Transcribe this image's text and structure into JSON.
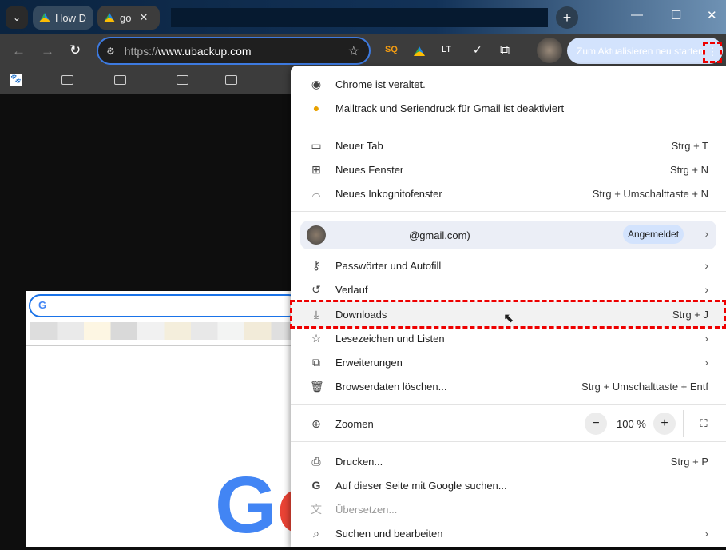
{
  "tabs": [
    {
      "title": "How D"
    },
    {
      "title": "go"
    }
  ],
  "tab_close": "✕",
  "new_tab": "+",
  "window": {
    "minimize": "—",
    "maximize": "☐",
    "close": "✕"
  },
  "address": {
    "url_prefix": "https://",
    "url_host": "www.ubackup.com"
  },
  "update_button": "Zum Aktualisieren neu starten",
  "menu": {
    "notices": [
      {
        "label": "Chrome ist veraltet."
      },
      {
        "label": "Mailtrack und Seriendruck für Gmail ist deaktiviert"
      }
    ],
    "group1": [
      {
        "label": "Neuer Tab",
        "shortcut": "Strg + T"
      },
      {
        "label": "Neues Fenster",
        "shortcut": "Strg + N"
      },
      {
        "label": "Neues Inkognitofenster",
        "shortcut": "Strg + Umschalttaste + N"
      }
    ],
    "profile": {
      "email": "@gmail.com)",
      "badge": "Angemeldet"
    },
    "group2": [
      {
        "label": "Passwörter und Autofill"
      },
      {
        "label": "Verlauf"
      },
      {
        "label": "Downloads",
        "shortcut": "Strg + J"
      },
      {
        "label": "Lesezeichen und Listen"
      },
      {
        "label": "Erweiterungen"
      },
      {
        "label": "Browserdaten löschen...",
        "shortcut": "Strg + Umschalttaste + Entf"
      }
    ],
    "zoom": {
      "label": "Zoomen",
      "value": "100 %",
      "minus": "−",
      "plus": "+"
    },
    "group3": [
      {
        "label": "Drucken...",
        "shortcut": "Strg + P"
      },
      {
        "label": "Auf dieser Seite mit Google suchen..."
      },
      {
        "label": "Übersetzen..."
      },
      {
        "label": "Suchen und bearbeiten"
      }
    ]
  },
  "colors": {
    "accent": "#3d7ae0",
    "highlight": "#ee0000"
  }
}
